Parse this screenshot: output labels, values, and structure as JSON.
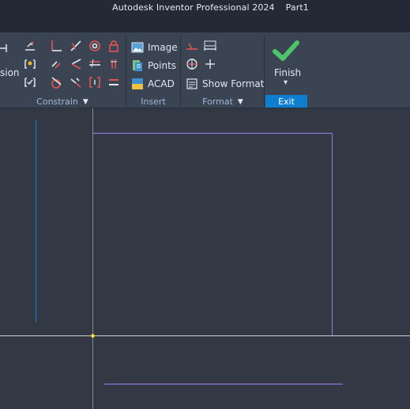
{
  "titlebar": {
    "title": "Autodesk Inventor Professional 2024",
    "document": "Part1"
  },
  "ribbon": {
    "constrain": {
      "partial_label": "sion",
      "panel_label": "Constrain",
      "dropdown_glyph": "▼"
    },
    "insert": {
      "panel_label": "Insert",
      "items": [
        {
          "label": "Image",
          "icon": "image-icon"
        },
        {
          "label": "Points",
          "icon": "points-icon"
        },
        {
          "label": "ACAD",
          "icon": "acad-icon"
        }
      ]
    },
    "format": {
      "panel_label": "Format",
      "dropdown_glyph": "▼",
      "show_format_label": "Show Format"
    },
    "exit": {
      "finish_label": "Finish",
      "finish_dropdown_glyph": "▾",
      "panel_label": "Exit"
    }
  },
  "colors": {
    "accent_blue": "#0f7ed1",
    "sketch_purple": "#8a73d4",
    "axis_blue": "#1f6fb2",
    "point_yellow": "#f0e03c",
    "constraint_red": "#e05454",
    "finish_green": "#4fc36b"
  }
}
